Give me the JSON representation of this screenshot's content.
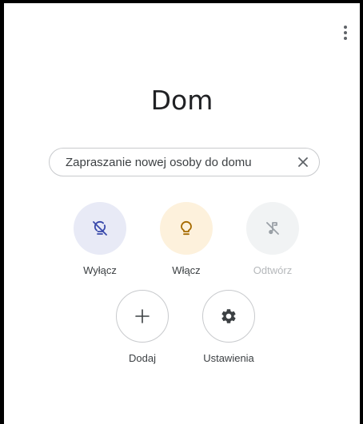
{
  "home": {
    "title": "Dom"
  },
  "invite_chip": {
    "label": "Zapraszanie nowej osoby do domu",
    "close_icon": "close-icon"
  },
  "actions": [
    {
      "label": "Wyłącz",
      "icon": "lightbulb-off-icon",
      "bg": "#e8eaf6",
      "color": "#3949ab",
      "enabled": true
    },
    {
      "label": "Włącz",
      "icon": "lightbulb-icon",
      "bg": "#fdf1dc",
      "color": "#a66b00",
      "enabled": true
    },
    {
      "label": "Odtwórz",
      "icon": "music-off-icon",
      "bg": "#f1f3f4",
      "color": "#9aa0a6",
      "enabled": false
    },
    {
      "label": "Dodaj",
      "icon": "plus-icon",
      "bg": "#ffffff",
      "color": "#3c4043",
      "enabled": true
    },
    {
      "label": "Ustawienia",
      "icon": "gear-icon",
      "bg": "#ffffff",
      "color": "#3c4043",
      "enabled": true
    }
  ]
}
